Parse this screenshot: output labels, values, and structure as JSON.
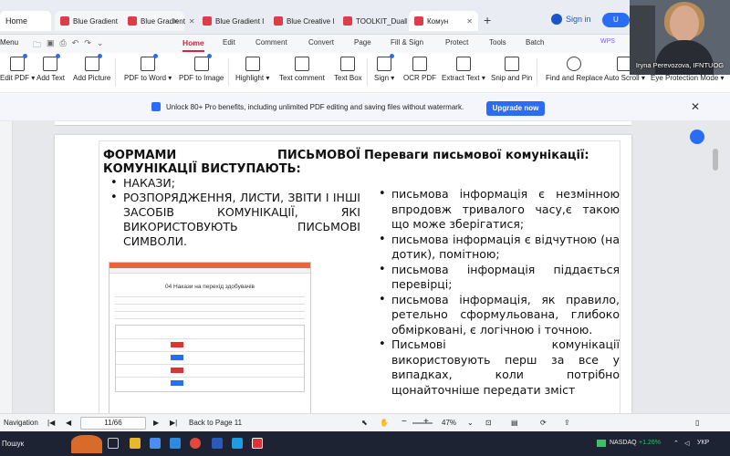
{
  "browser_tabs": {
    "home": "Home",
    "items": [
      {
        "label": "Blue Gradient"
      },
      {
        "label": "Blue Gradient I"
      },
      {
        "label": "Blue Creative I"
      },
      {
        "label": "TOOLKIT_Duall"
      },
      {
        "label": "Комун"
      }
    ],
    "sign_in": "Sign in",
    "upgrade_short": "U"
  },
  "menubar": {
    "menu_label": "Menu",
    "items": [
      "Home",
      "Edit",
      "Comment",
      "Convert",
      "Page",
      "Fill & Sign",
      "Protect",
      "Tools",
      "Batch"
    ],
    "active": "Home",
    "wps": "WPS"
  },
  "toolbar": {
    "tools": [
      "Edit PDF",
      "Add Text",
      "Add Picture",
      "PDF to Word",
      "PDF to Image",
      "Highlight",
      "Text comment",
      "Text Box",
      "Sign",
      "OCR PDF",
      "Extract Text",
      "Snip and Pin",
      "Find and Replace",
      "Auto Scroll",
      "Eye Protection Mode"
    ],
    "dropdown_tools": [
      "Edit PDF",
      "PDF to Word",
      "Highlight",
      "Sign",
      "Extract Text",
      "Auto Scroll",
      "Eye Protection Mode"
    ]
  },
  "notification": {
    "message": "Unlock 80+ Pro benefits, including unlimited PDF editing and saving files without watermark.",
    "button": "Upgrade now"
  },
  "slide": {
    "left_heading": "ФОРМАМИ ПИСЬМОВОЇ КОМУНІКАЦІЇ ВИСТУПАЮТЬ:",
    "left_items": [
      "НАКАЗИ;",
      "РОЗПОРЯДЖЕННЯ, ЛИСТИ, ЗВІТИ І ІНШІ ЗАСОБІВ КОМУНІКАЦІЇ, ЯКІ ВИКОРИСТОВУЮТЬ ПИСЬМОВІ СИМВОЛИ."
    ],
    "right_heading": "Переваги письмової комунікації:",
    "right_items": [
      "письмова інформація є незмінною впродовж тривалого часу,є такою що може зберігатися;",
      "письмова інформація є відчутною (на дотик), помітною;",
      "письмова інформація піддається перевірці;",
      "письмова інформація, як правило, ретельно сформульована, глибоко обмірковані, є логічною і точною.",
      "Письмові комунікації використовують перш за все у випадках, коли потрібно щонайточніше передати зміст"
    ],
    "embed_title": "04 Накази на перехід здобувачів"
  },
  "statusbar": {
    "navigation": "Navigation",
    "page": "11/66",
    "back": "Back to Page 11",
    "zoom": "47%"
  },
  "taskbar": {
    "search": "Пошук",
    "nasdaq_label": "NASDAQ",
    "nasdaq_change": "+1.26%",
    "lang": "УКР"
  },
  "video": {
    "name": "Iryna Perevozova, IFNTUOG"
  }
}
